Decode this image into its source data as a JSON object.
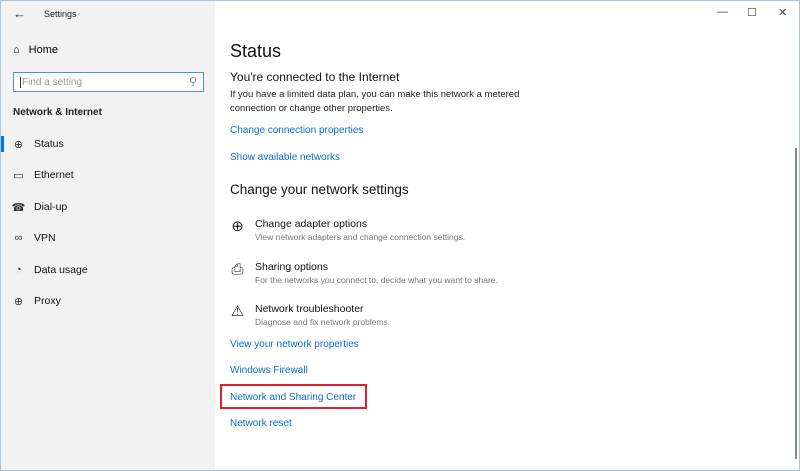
{
  "window": {
    "title": "Settings",
    "back_icon": "←",
    "minimize": "—",
    "maximize": "☐",
    "close": "✕"
  },
  "sidebar": {
    "home": "Home",
    "search_placeholder": "Find a setting",
    "section": "Network & Internet",
    "items": [
      {
        "label": "Status",
        "icon": "globe-monitor"
      },
      {
        "label": "Ethernet",
        "icon": "ethernet"
      },
      {
        "label": "Dial-up",
        "icon": "dial-up"
      },
      {
        "label": "VPN",
        "icon": "vpn"
      },
      {
        "label": "Data usage",
        "icon": "pie"
      },
      {
        "label": "Proxy",
        "icon": "globe"
      }
    ]
  },
  "main": {
    "title": "Status",
    "connected": "You're connected to the Internet",
    "description": "If you have a limited data plan, you can make this network a metered connection or change other properties.",
    "link_change_properties": "Change connection properties",
    "link_show_networks": "Show available networks",
    "section": "Change your network settings",
    "options": [
      {
        "title": "Change adapter options",
        "desc": "View network adapters and change connection settings."
      },
      {
        "title": "Sharing options",
        "desc": "For the networks you connect to, decide what you want to share."
      },
      {
        "title": "Network troubleshooter",
        "desc": "Diagnose and fix network problems."
      }
    ],
    "links": [
      "View your network properties",
      "Windows Firewall",
      "Network and Sharing Center",
      "Network reset"
    ]
  },
  "colors": {
    "accent": "#0078d7",
    "link": "#0a6fd0",
    "highlight": "#e0202a"
  }
}
